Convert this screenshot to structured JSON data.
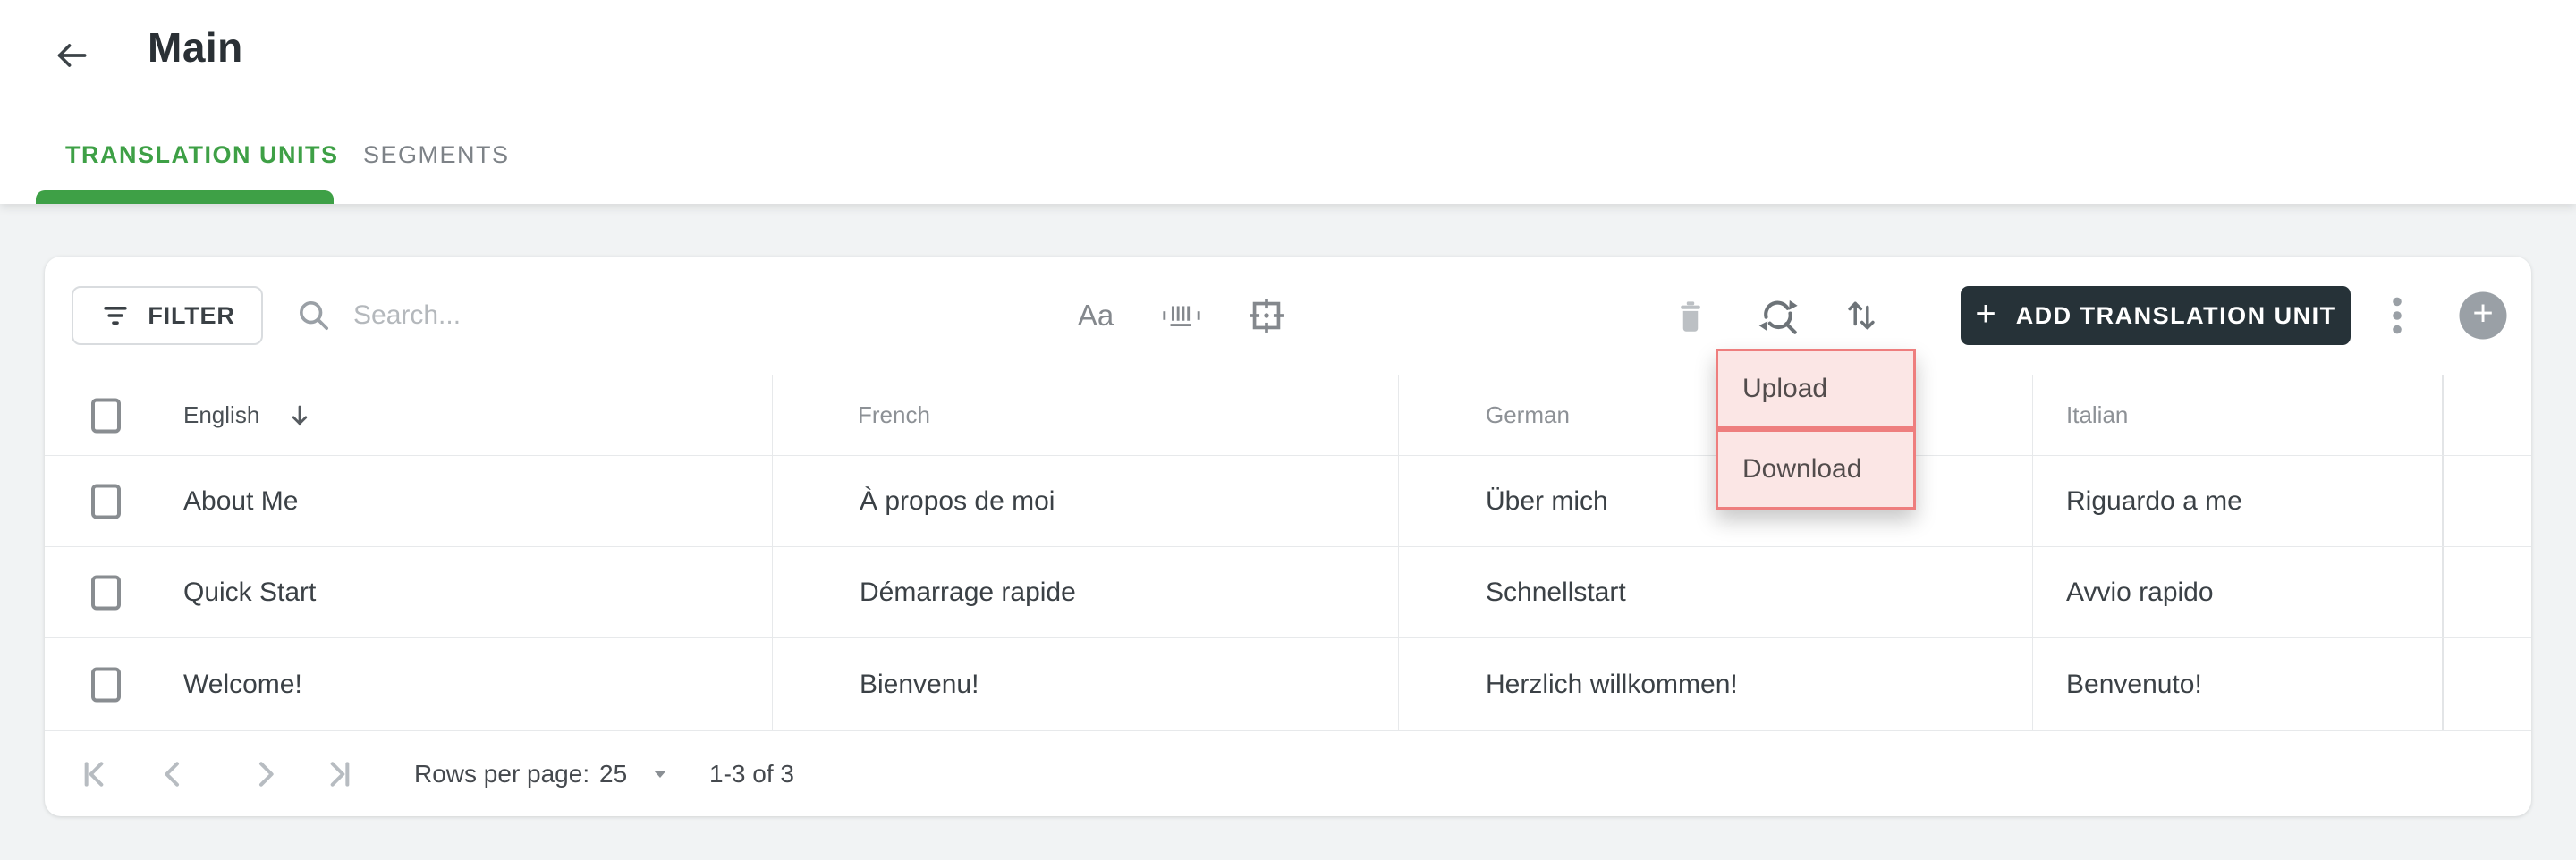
{
  "page": {
    "title": "Main"
  },
  "tabs": {
    "translation_units": "TRANSLATION UNITS",
    "segments": "SEGMENTS"
  },
  "toolbar": {
    "filter": "FILTER",
    "search_placeholder": "Search...",
    "text_case_icon": "Aa",
    "add_unit": "ADD TRANSLATION UNIT",
    "add_plus": "+",
    "fab_plus": "+"
  },
  "menu": {
    "upload": "Upload",
    "download": "Download"
  },
  "table": {
    "headers": {
      "english": "English",
      "french": "French",
      "german": "German",
      "italian": "Italian"
    },
    "sort": {
      "column": "English",
      "direction": "desc"
    },
    "rows": [
      {
        "english": "About Me",
        "french": "À propos de moi",
        "german": "Über mich",
        "italian": "Riguardo a me"
      },
      {
        "english": "Quick Start",
        "french": "Démarrage rapide",
        "german": "Schnellstart",
        "italian": "Avvio rapido"
      },
      {
        "english": "Welcome!",
        "french": "Bienvenu!",
        "german": "Herzlich willkommen!",
        "italian": "Benvenuto!"
      }
    ]
  },
  "footer": {
    "rows_per_page": "Rows per page:",
    "page_size": "25",
    "range": "1-3 of 3"
  },
  "colors": {
    "accent_green": "#3ea046",
    "dark_button": "#263238",
    "page_background": "#f1f3f4",
    "highlight_border": "#ee7e7e",
    "highlight_fill": "#fbe6e5",
    "table_border": "#e7e9eb"
  }
}
